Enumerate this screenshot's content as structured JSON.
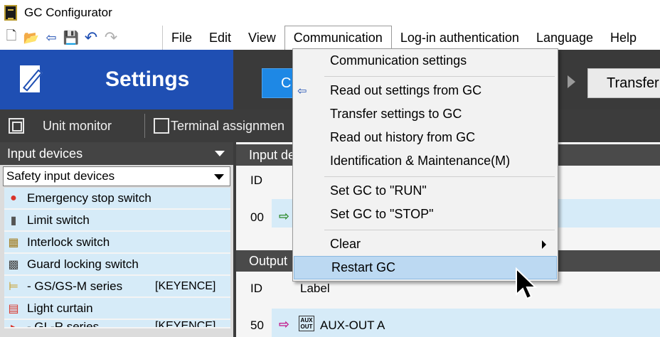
{
  "window": {
    "title": "GC Configurator"
  },
  "toolbar": {
    "icons": [
      "new-file-icon",
      "open-folder-icon",
      "import-icon",
      "save-icon",
      "undo-icon",
      "redo-icon"
    ],
    "glyphs": [
      "🗋",
      "📂",
      "⇦",
      "💾",
      "↶",
      "↷"
    ]
  },
  "menu": {
    "items": [
      "File",
      "Edit",
      "View",
      "Communication",
      "Log-in authentication",
      "Language",
      "Help"
    ],
    "active": "Communication"
  },
  "settings": {
    "label": "Settings"
  },
  "header_buttons": {
    "blue_button": "C",
    "transfer": "Transfer"
  },
  "tabs": {
    "unit_monitor": "Unit monitor",
    "terminal_assignment": "Terminal assignmen"
  },
  "left_panel": {
    "header": "Input devices",
    "select_value": "Safety input devices",
    "devices": [
      {
        "icon": "●",
        "label": "Emergency stop switch",
        "tag": ""
      },
      {
        "icon": "▮",
        "label": "Limit switch",
        "tag": ""
      },
      {
        "icon": "▦",
        "label": "Interlock switch",
        "tag": ""
      },
      {
        "icon": "▩",
        "label": "Guard locking switch",
        "tag": ""
      },
      {
        "icon": "⊨",
        "label": "- GS/GS-M series",
        "tag": "[KEYENCE]"
      },
      {
        "icon": "▤",
        "label": "Light curtain",
        "tag": ""
      },
      {
        "icon": "▸",
        "label": "- GL-R series",
        "tag": "[KEYENCE]"
      }
    ]
  },
  "right_area": {
    "input_header": "Input de",
    "output_header": "Output",
    "id_label": "ID",
    "label_col": "Label",
    "input_row_id": "00",
    "output_row_id": "50",
    "output_row_label": "AUX-OUT A",
    "aux_box": [
      "AUX",
      "OUT"
    ]
  },
  "dropdown": {
    "items": [
      "Communication settings",
      "Read out settings from GC",
      "Transfer settings to GC",
      "Read out history from GC",
      "Identification & Maintenance(M)",
      "Set GC to \"RUN\"",
      "Set GC to \"STOP\"",
      "Clear",
      "Restart GC"
    ],
    "highlighted": "Restart GC"
  },
  "colors": {
    "settings_blue": "#1f4fb3",
    "highlight": "#bcd9f2",
    "row_blue": "#d6ebf8",
    "dark_band": "#3c3c3c"
  }
}
